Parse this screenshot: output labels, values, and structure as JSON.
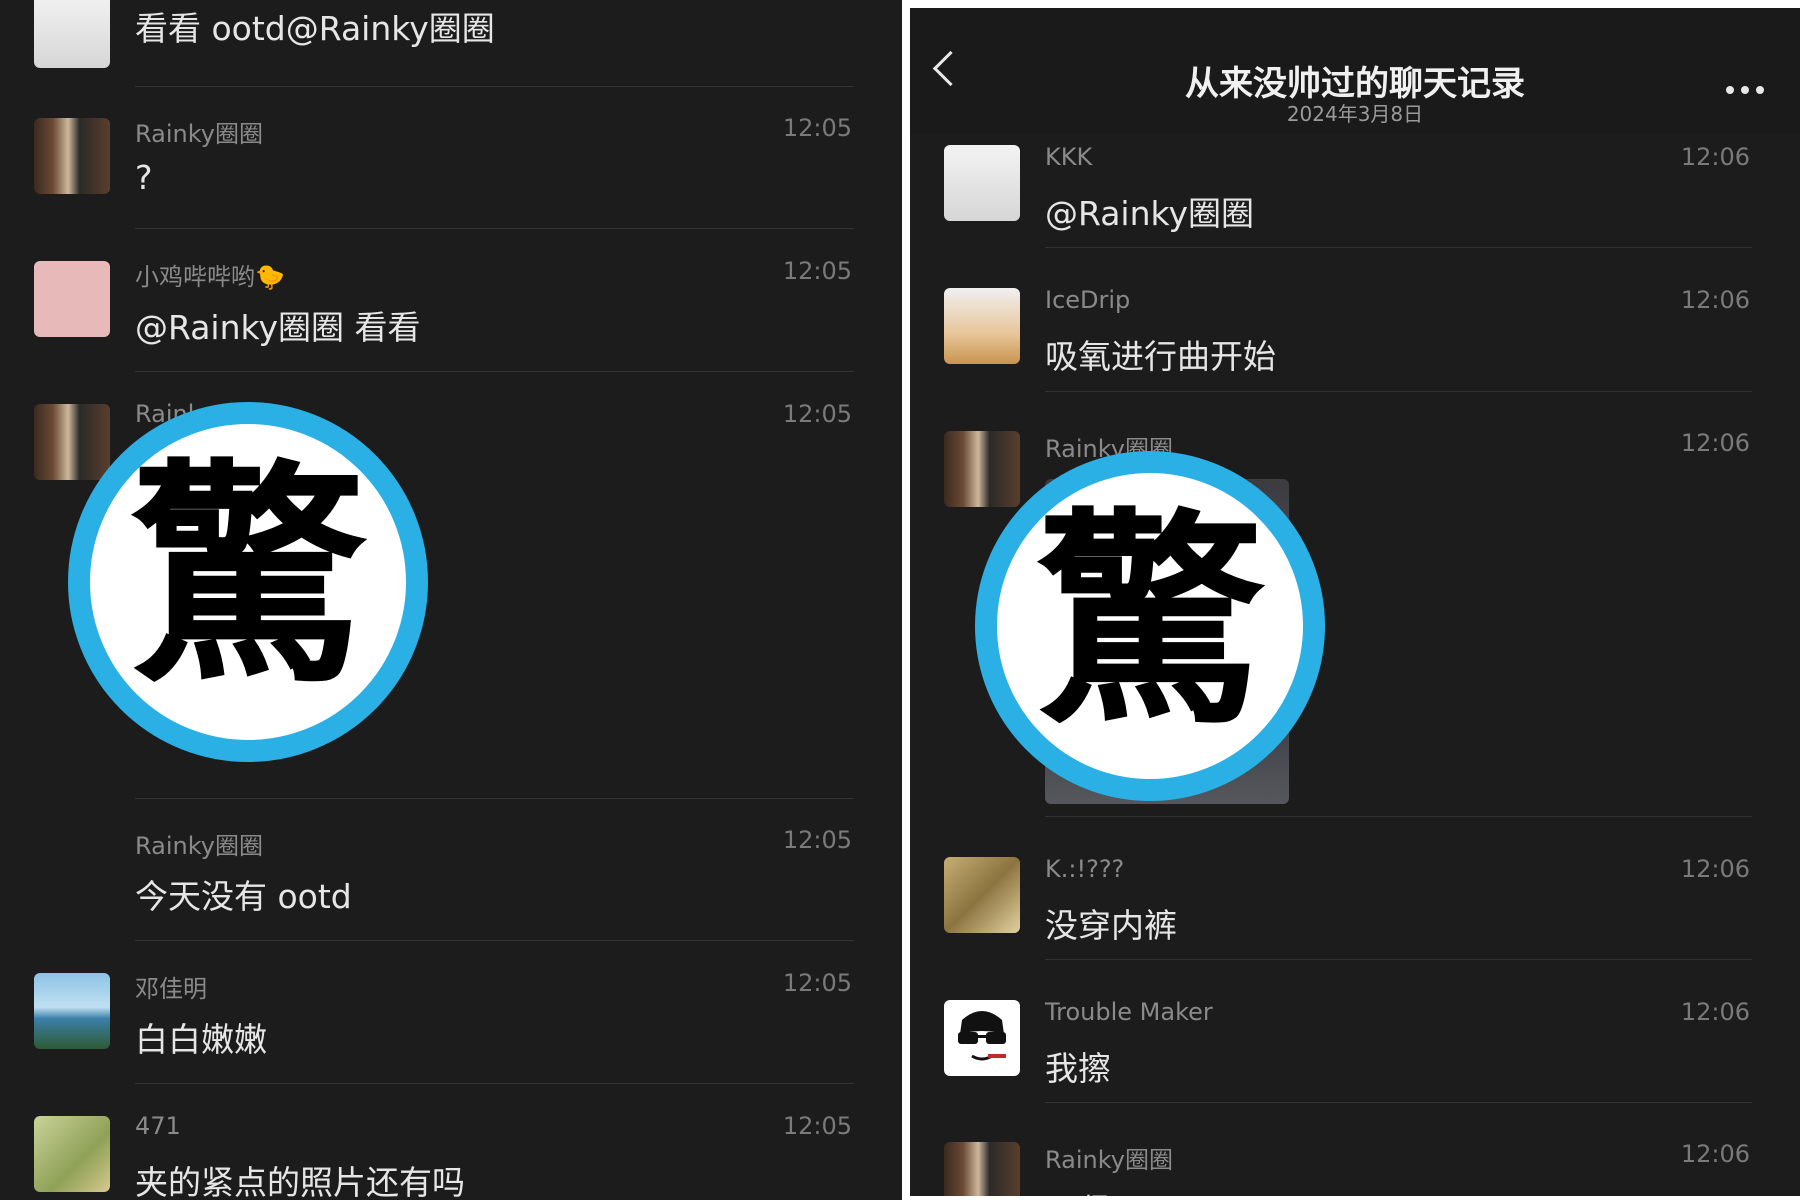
{
  "left": {
    "messages": [
      {
        "sender": "",
        "time": "",
        "text": "看看 ootd@Rainky圈圈"
      },
      {
        "sender": "Rainky圈圈",
        "time": "12:05",
        "text": "?"
      },
      {
        "sender": "小鸡哔哔哟🐤",
        "time": "12:05",
        "text": "@Rainky圈圈 看看"
      },
      {
        "sender": "Rainky",
        "time": "12:05",
        "text": ""
      },
      {
        "sender": "Rainky圈圈",
        "time": "12:05",
        "text": "今天没有 ootd"
      },
      {
        "sender": "邓佳明",
        "time": "12:05",
        "text": "白白嫩嫩"
      },
      {
        "sender": "471",
        "time": "12:05",
        "text": "夹的紧点的照片还有吗"
      }
    ]
  },
  "right": {
    "header": {
      "title": "从来没帅过的聊天记录",
      "date": "2024年3月8日"
    },
    "messages": [
      {
        "sender": "KKK",
        "time": "12:06",
        "text": "@Rainky圈圈"
      },
      {
        "sender": "IceDrip",
        "time": "12:06",
        "text": "吸氧进行曲开始"
      },
      {
        "sender": "Rainky圈圈",
        "time": "12:06",
        "text": ""
      },
      {
        "sender": "K.:!???",
        "time": "12:06",
        "text": "没穿内裤"
      },
      {
        "sender": "Trouble Maker",
        "time": "12:06",
        "text": "我擦"
      },
      {
        "sender": "Rainky圈圈",
        "time": "12:06",
        "text": "不紧了吧"
      }
    ]
  },
  "stamp": {
    "character": "驚",
    "ring_color": "#2ab0e4"
  },
  "icons": {
    "back": "back-chevron-icon",
    "more": "more-dots-icon"
  }
}
